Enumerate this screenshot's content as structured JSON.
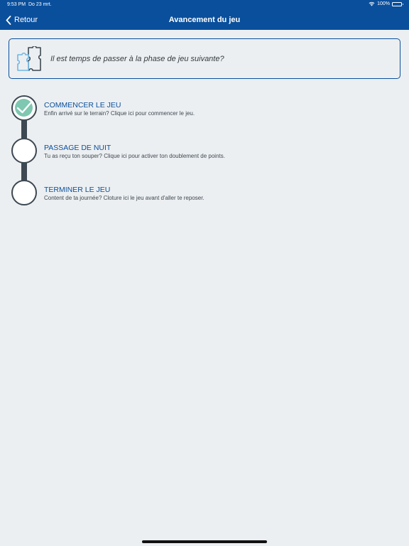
{
  "status_bar": {
    "time": "9:53 PM",
    "date": "Do 23 mrt.",
    "battery": "100%",
    "battery_level": 1.0
  },
  "nav": {
    "back_label": "Retour",
    "title": "Avancement du jeu"
  },
  "card": {
    "message": "Il est temps de passer à la phase de jeu suivante?",
    "icon": "puzzle-icon"
  },
  "steps": [
    {
      "title": "COMMENCER LE JEU",
      "description": "Enfin arrivé sur le terrain? Clique ici pour commencer le jeu.",
      "completed": true
    },
    {
      "title": "PASSAGE DE NUIT",
      "description": "Tu as reçu ton souper?  Clique ici pour activer ton doublement de points.",
      "completed": false
    },
    {
      "title": "TERMINER LE JEU",
      "description": "Content de ta journée?  Cloture ici le jeu avant d'aller te reposer.",
      "completed": false
    }
  ],
  "colors": {
    "primary": "#0a4f9c",
    "background": "#eceff1",
    "timeline": "#3d4852",
    "check": "#7ec7b0"
  }
}
